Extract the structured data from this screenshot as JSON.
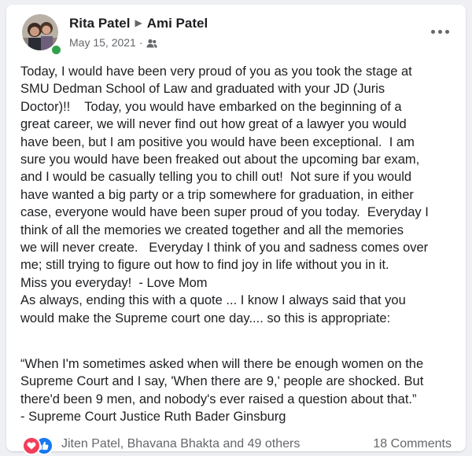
{
  "post": {
    "author": "Rita Patel",
    "recipient": "Ami Patel",
    "date": "May 15, 2021",
    "audience_icon": "friends-icon",
    "body_lines": [
      "Today, I would have been very proud of you as you took the stage at",
      "SMU Dedman School of Law and graduated with your JD (Juris",
      "Doctor)!!    Today, you would have embarked on the beginning of a",
      "great career, we will never find out how great of a lawyer you would",
      "have been, but I am positive you would have been exceptional.  I am",
      "sure you would have been freaked out about the upcoming bar exam,",
      "and I would be casually telling you to chill out!  Not sure if you would",
      "have wanted a big party or a trip somewhere for graduation, in either",
      "case, everyone would have been super proud of you today.  Everyday I",
      "think of all the memories we created together and all the memories",
      "we will never create.   Everyday I think of you and sadness comes over",
      "me; still trying to figure out how to find joy in life without you in it.",
      "Miss you everyday!  - Love Mom",
      "As always, ending this with a quote ... I know I always said that you",
      "would make the Supreme court one day.... so this is appropriate:"
    ],
    "quote_lines": [
      "“When I'm sometimes asked when will there be enough women on the",
      "Supreme Court and I say, 'When there are 9,' people are shocked. But",
      "there'd been 9 men, and nobody's ever raised a question about that.”",
      "- Supreme Court Justice Ruth Bader Ginsburg"
    ]
  },
  "reactions": {
    "icons": [
      "love-icon",
      "like-icon"
    ],
    "text": "Jiten Patel, Bhavana Bhakta and 49 others",
    "comments": "18 Comments"
  },
  "colors": {
    "online": "#31a24c",
    "love": "#f33e58",
    "like": "#1877f2",
    "meta_text": "#65676b"
  }
}
